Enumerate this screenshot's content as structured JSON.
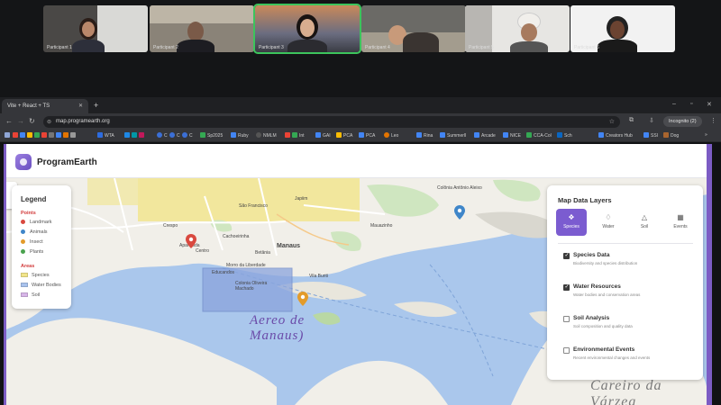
{
  "call": {
    "participants": [
      {
        "name": "Participant 1"
      },
      {
        "name": "Participant 2"
      },
      {
        "name": "Participant 3"
      },
      {
        "name": "Participant 4"
      },
      {
        "name": "Participant 5"
      },
      {
        "name": "Participant 6"
      }
    ]
  },
  "browser": {
    "tab_title": "Vite + React + TS",
    "new_tab": "+",
    "url": "map.programearth.org",
    "incognito": "Incognito (2)",
    "bookmarks": [
      "WTA",
      "C",
      "C",
      "C",
      "Sp2025",
      "Ruby",
      "NMLM",
      "Int",
      "GAI",
      "PCA",
      "PCA",
      "Leo",
      "Rina",
      "Summerll",
      "Arcade",
      "NICE",
      "CCA-Col",
      "Sch",
      "Creators Hub",
      "SSI",
      "Dog"
    ]
  },
  "app": {
    "title": "ProgramEarth"
  },
  "legend": {
    "title": "Legend",
    "points_heading": "Points",
    "points": [
      {
        "label": "Landmark",
        "color": "#d9493f"
      },
      {
        "label": "Animals",
        "color": "#3f86c9"
      },
      {
        "label": "Insect",
        "color": "#e39b2a"
      },
      {
        "label": "Plants",
        "color": "#4aa34e"
      }
    ],
    "areas_heading": "Areas",
    "areas": [
      {
        "label": "Species",
        "color": "#f2e58a"
      },
      {
        "label": "Water Bodies",
        "color": "#a9c3ee"
      },
      {
        "label": "Soil",
        "color": "#d7b6e8"
      }
    ]
  },
  "layers": {
    "title": "Map Data Layers",
    "tabs": [
      {
        "label": "Species",
        "icon": "paw-icon"
      },
      {
        "label": "Water",
        "icon": "droplet-icon"
      },
      {
        "label": "Soil",
        "icon": "mountain-icon"
      },
      {
        "label": "Events",
        "icon": "calendar-icon"
      }
    ],
    "items": [
      {
        "title": "Species Data",
        "desc": "Biodiversity and species distribution",
        "checked": true
      },
      {
        "title": "Water Resources",
        "desc": "Water bodies and conservation areas",
        "checked": true
      },
      {
        "title": "Soil Analysis",
        "desc": "Soil composition and quality data",
        "checked": false
      },
      {
        "title": "Environmental Events",
        "desc": "Recent environmental changes and events",
        "checked": false
      }
    ]
  },
  "map": {
    "labels": [
      "Colônia Antônio Aleixo",
      "Centro",
      "Cachoeirinha",
      "Manaus",
      "Betânia",
      "Morro da Liberdade",
      "Educandos",
      "Colonia Oliveira Machado",
      "Vila Buriti",
      "Mauazinho",
      "Crespo",
      "Japiim",
      "São Francisco",
      "Aparecida"
    ],
    "river_label": "Aereo de Manaus)",
    "corner_label": "Careiro da Várzea"
  }
}
